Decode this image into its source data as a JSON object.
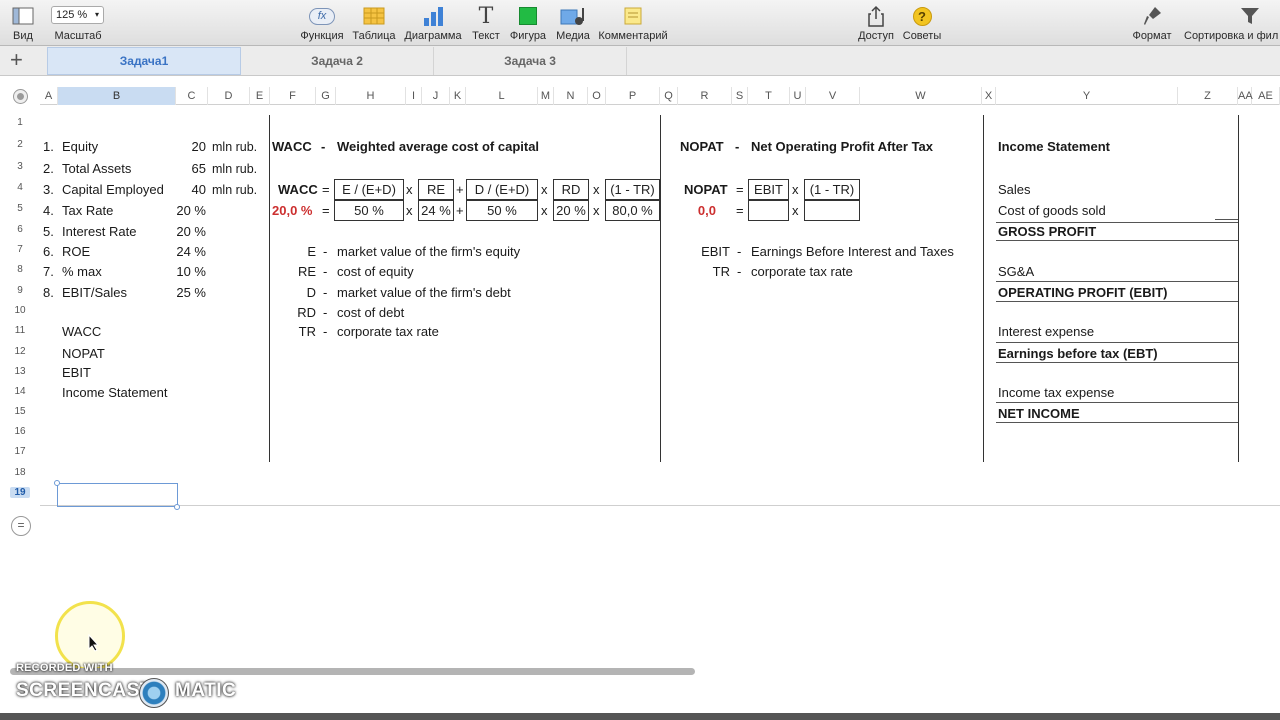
{
  "toolbar": {
    "view_label": "Вид",
    "zoom_value": "125 %",
    "zoom_label": "Масштаб",
    "function_label": "Функция",
    "function_icon_text": "fx",
    "table_label": "Таблица",
    "chart_label": "Диаграмма",
    "text_label": "Текст",
    "text_icon_text": "T",
    "shape_label": "Фигура",
    "media_label": "Медиа",
    "comment_label": "Комментарий",
    "share_label": "Доступ",
    "tips_label": "Советы",
    "tips_icon_text": "?",
    "format_label": "Формат",
    "sort_label": "Сортировка и фил",
    "shape_color": "#22bb44",
    "table_color": "#f5c342",
    "chart_color": "#3f82d6"
  },
  "sheets": {
    "add_symbol": "+",
    "tabs": [
      "Задача1",
      "Задача 2",
      "Задача 3"
    ]
  },
  "grid": {
    "columns": [
      "A",
      "B",
      "C",
      "D",
      "E",
      "F",
      "G",
      "H",
      "I",
      "J",
      "K",
      "L",
      "M",
      "N",
      "O",
      "P",
      "Q",
      "R",
      "S",
      "T",
      "U",
      "V",
      "W",
      "X",
      "Y",
      "Z",
      "AA",
      "AE"
    ],
    "rows": [
      "1",
      "2",
      "3",
      "4",
      "5",
      "6",
      "7",
      "8",
      "9",
      "10",
      "11",
      "12",
      "13",
      "14",
      "15",
      "16",
      "17",
      "18",
      "19"
    ],
    "add_row_symbol": "="
  },
  "inputs": {
    "items": [
      {
        "num": "1.",
        "label": "Equity",
        "value": "20",
        "unit": "mln rub."
      },
      {
        "num": "2.",
        "label": "Total Assets",
        "value": "65",
        "unit": "mln rub."
      },
      {
        "num": "3.",
        "label": "Capital Employed",
        "value": "40",
        "unit": "mln rub."
      },
      {
        "num": "4.",
        "label": "Tax Rate",
        "value": "20 %",
        "unit": ""
      },
      {
        "num": "5.",
        "label": "Interest Rate",
        "value": "20 %",
        "unit": ""
      },
      {
        "num": "6.",
        "label": "ROE",
        "value": "24 %",
        "unit": ""
      },
      {
        "num": "7.",
        "label": "% max",
        "value": "10 %",
        "unit": ""
      },
      {
        "num": "8.",
        "label": "EBIT/Sales",
        "value": "25 %",
        "unit": ""
      }
    ],
    "links": [
      "WACC",
      "NOPAT",
      "EBIT",
      "Income Statement"
    ]
  },
  "wacc": {
    "abbr": "WACC",
    "dash": "-",
    "title": "Weighted average cost of capital",
    "formula_label": "WACC",
    "eq": "=",
    "times": "x",
    "plus": "+",
    "terms": [
      "E / (E+D)",
      "RE",
      "D / (E+D)",
      "RD",
      "(1 - TR)"
    ],
    "result": "20,0 %",
    "values": [
      "50 %",
      "24 %",
      "50 %",
      "20 %",
      "80,0 %"
    ],
    "legend": [
      {
        "sym": "E",
        "text": "market value of the firm's equity"
      },
      {
        "sym": "RE",
        "text": "cost of equity"
      },
      {
        "sym": "D",
        "text": "market value of the firm's debt"
      },
      {
        "sym": "RD",
        "text": "cost of debt"
      },
      {
        "sym": "TR",
        "text": "corporate tax rate"
      }
    ]
  },
  "nopat": {
    "abbr": "NOPAT",
    "dash": "-",
    "title": "Net Operating Profit After Tax",
    "formula_label": "NOPAT",
    "eq": "=",
    "times": "x",
    "terms": [
      "EBIT",
      "(1 - TR)"
    ],
    "result": "0,0",
    "legend": [
      {
        "sym": "EBIT",
        "text": "Earnings Before Interest and Taxes"
      },
      {
        "sym": "TR",
        "text": "corporate tax rate"
      }
    ]
  },
  "income": {
    "title": "Income Statement",
    "lines": [
      "Sales",
      "Cost of goods sold",
      "GROSS PROFIT",
      "SG&A",
      "OPERATING PROFIT (EBIT)",
      "Interest expense",
      "Earnings before tax (EBT)",
      "Income tax expense",
      "NET INCOME"
    ]
  },
  "recorder": {
    "line1": "RECORDED WITH",
    "brand_left": "SCREENCAST",
    "brand_right": "MATIC"
  }
}
